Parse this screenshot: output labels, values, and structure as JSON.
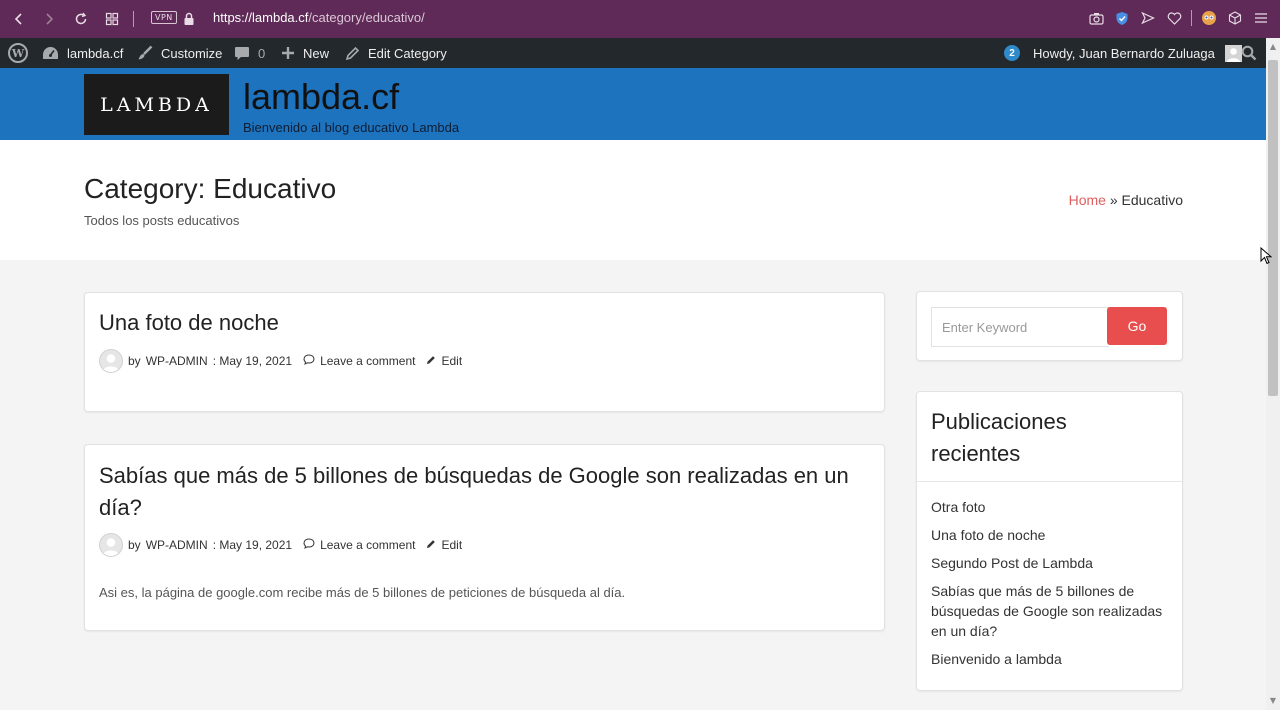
{
  "browser": {
    "vpn_label": "VPN",
    "url_host": "https://lambda.cf",
    "url_path": "/category/educativo/"
  },
  "adminbar": {
    "site": "lambda.cf",
    "customize": "Customize",
    "comments_count": "0",
    "new": "New",
    "edit_category": "Edit Category",
    "notifications": "2",
    "howdy": "Howdy, Juan Bernardo Zuluaga"
  },
  "header": {
    "logo_text": "LAMBDA",
    "title": "lambda.cf",
    "tagline": "Bienvenido al blog educativo Lambda",
    "color": "#1e73be"
  },
  "page": {
    "title": "Category: Educativo",
    "description": "Todos los posts educativos",
    "breadcrumb_home": "Home",
    "breadcrumb_sep": "»",
    "breadcrumb_current": "Educativo"
  },
  "posts": [
    {
      "title": "Una foto de noche",
      "by": "by",
      "author": "WP-ADMIN",
      "date": ": May 19, 2021",
      "comment": "Leave a comment",
      "edit": "Edit"
    },
    {
      "title": "Sabías que más de 5 billones de búsquedas de Google son realizadas en un día?",
      "by": "by",
      "author": "WP-ADMIN",
      "date": ": May 19, 2021",
      "comment": "Leave a comment",
      "edit": "Edit",
      "excerpt": "Asi es, la página de google.com recibe más de 5 billones de peticiones de búsqueda al día."
    }
  ],
  "sidebar": {
    "search_placeholder": "Enter Keyword",
    "search_button": "Go",
    "recent_title": "Publicaciones recientes",
    "recent": [
      "Otra foto",
      "Una foto de noche",
      "Segundo Post de Lambda",
      "Sabías que más de 5 billones de búsquedas de Google son realizadas en un día?",
      "Bienvenido a lambda"
    ]
  },
  "colors": {
    "browser_bar": "#5f2a57",
    "adminbar": "#23282d",
    "accent": "#e84e4e"
  }
}
